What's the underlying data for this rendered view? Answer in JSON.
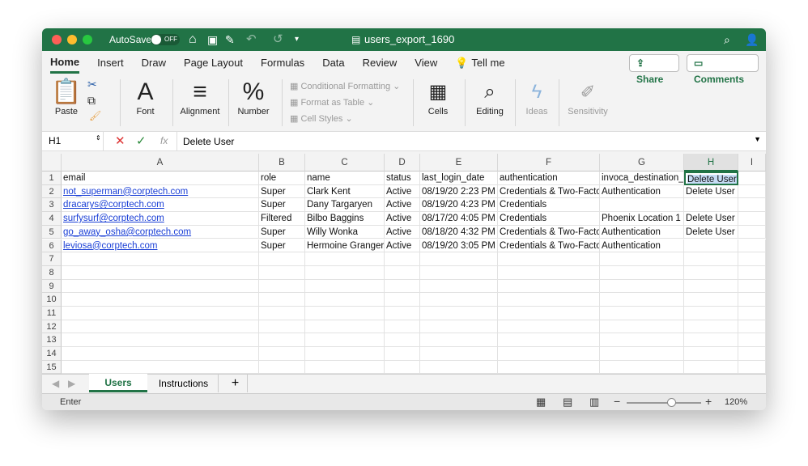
{
  "titlebar": {
    "autosave_label": "AutoSave",
    "autosave_state": "OFF",
    "filename": "users_export_1690"
  },
  "tabs": [
    "Home",
    "Insert",
    "Draw",
    "Page Layout",
    "Formulas",
    "Data",
    "Review",
    "View"
  ],
  "tell_me": "Tell me",
  "share_label": "Share",
  "comments_label": "Comments",
  "ribbon": {
    "paste": "Paste",
    "font": "Font",
    "alignment": "Alignment",
    "number": "Number",
    "conditional_formatting": "Conditional Formatting",
    "format_as_table": "Format as Table",
    "cell_styles": "Cell Styles",
    "cells": "Cells",
    "editing": "Editing",
    "ideas": "Ideas",
    "sensitivity": "Sensitivity"
  },
  "formula_bar": {
    "name_box": "H1",
    "fx": "fx",
    "value": "Delete User"
  },
  "columns": [
    "A",
    "B",
    "C",
    "D",
    "E",
    "F",
    "G",
    "H",
    "I"
  ],
  "row_numbers": [
    "1",
    "2",
    "3",
    "4",
    "5",
    "6",
    "7",
    "8",
    "9",
    "10",
    "11",
    "12",
    "13",
    "14",
    "15"
  ],
  "rows": [
    [
      "email",
      "role",
      "name",
      "status",
      "last_login_date",
      "authentication",
      "invoca_destination_f",
      "Delete User"
    ],
    [
      "not_superman@corptech.com",
      "Super",
      "Clark Kent",
      "Active",
      "08/19/20   2:23 PM",
      "Credentials & Two-Factor",
      "Authentication",
      "Delete User"
    ],
    [
      "dracarys@corptech.com",
      "Super",
      "Dany Targaryen",
      "Active",
      "08/19/20   4:23 PM",
      "Credentials",
      "",
      ""
    ],
    [
      "surfysurf@corptech.com",
      "Filtered",
      "Bilbo Baggins",
      "Active",
      "08/17/20   4:05 PM",
      "Credentials",
      "Phoenix Location 1",
      "Delete User"
    ],
    [
      "go_away_osha@corptech.com",
      "Super",
      "Willy Wonka",
      "Active",
      "08/18/20   4:32 PM",
      "Credentials & Two-Factor",
      "Authentication",
      "Delete User"
    ],
    [
      "leviosa@corptech.com",
      "Super",
      "Hermoine Granger",
      "Active",
      "08/19/20   3:05 PM",
      "Credentials & Two-Factor",
      "Authentication",
      ""
    ]
  ],
  "sheet_tabs": [
    "Users",
    "Instructions"
  ],
  "add_sheet": "+",
  "status": {
    "mode": "Enter",
    "zoom": "120%",
    "zoom_level": 0.6
  },
  "colors": {
    "accent": "#217346",
    "link": "#1a3fd6",
    "selection": "#c6dcf5"
  }
}
